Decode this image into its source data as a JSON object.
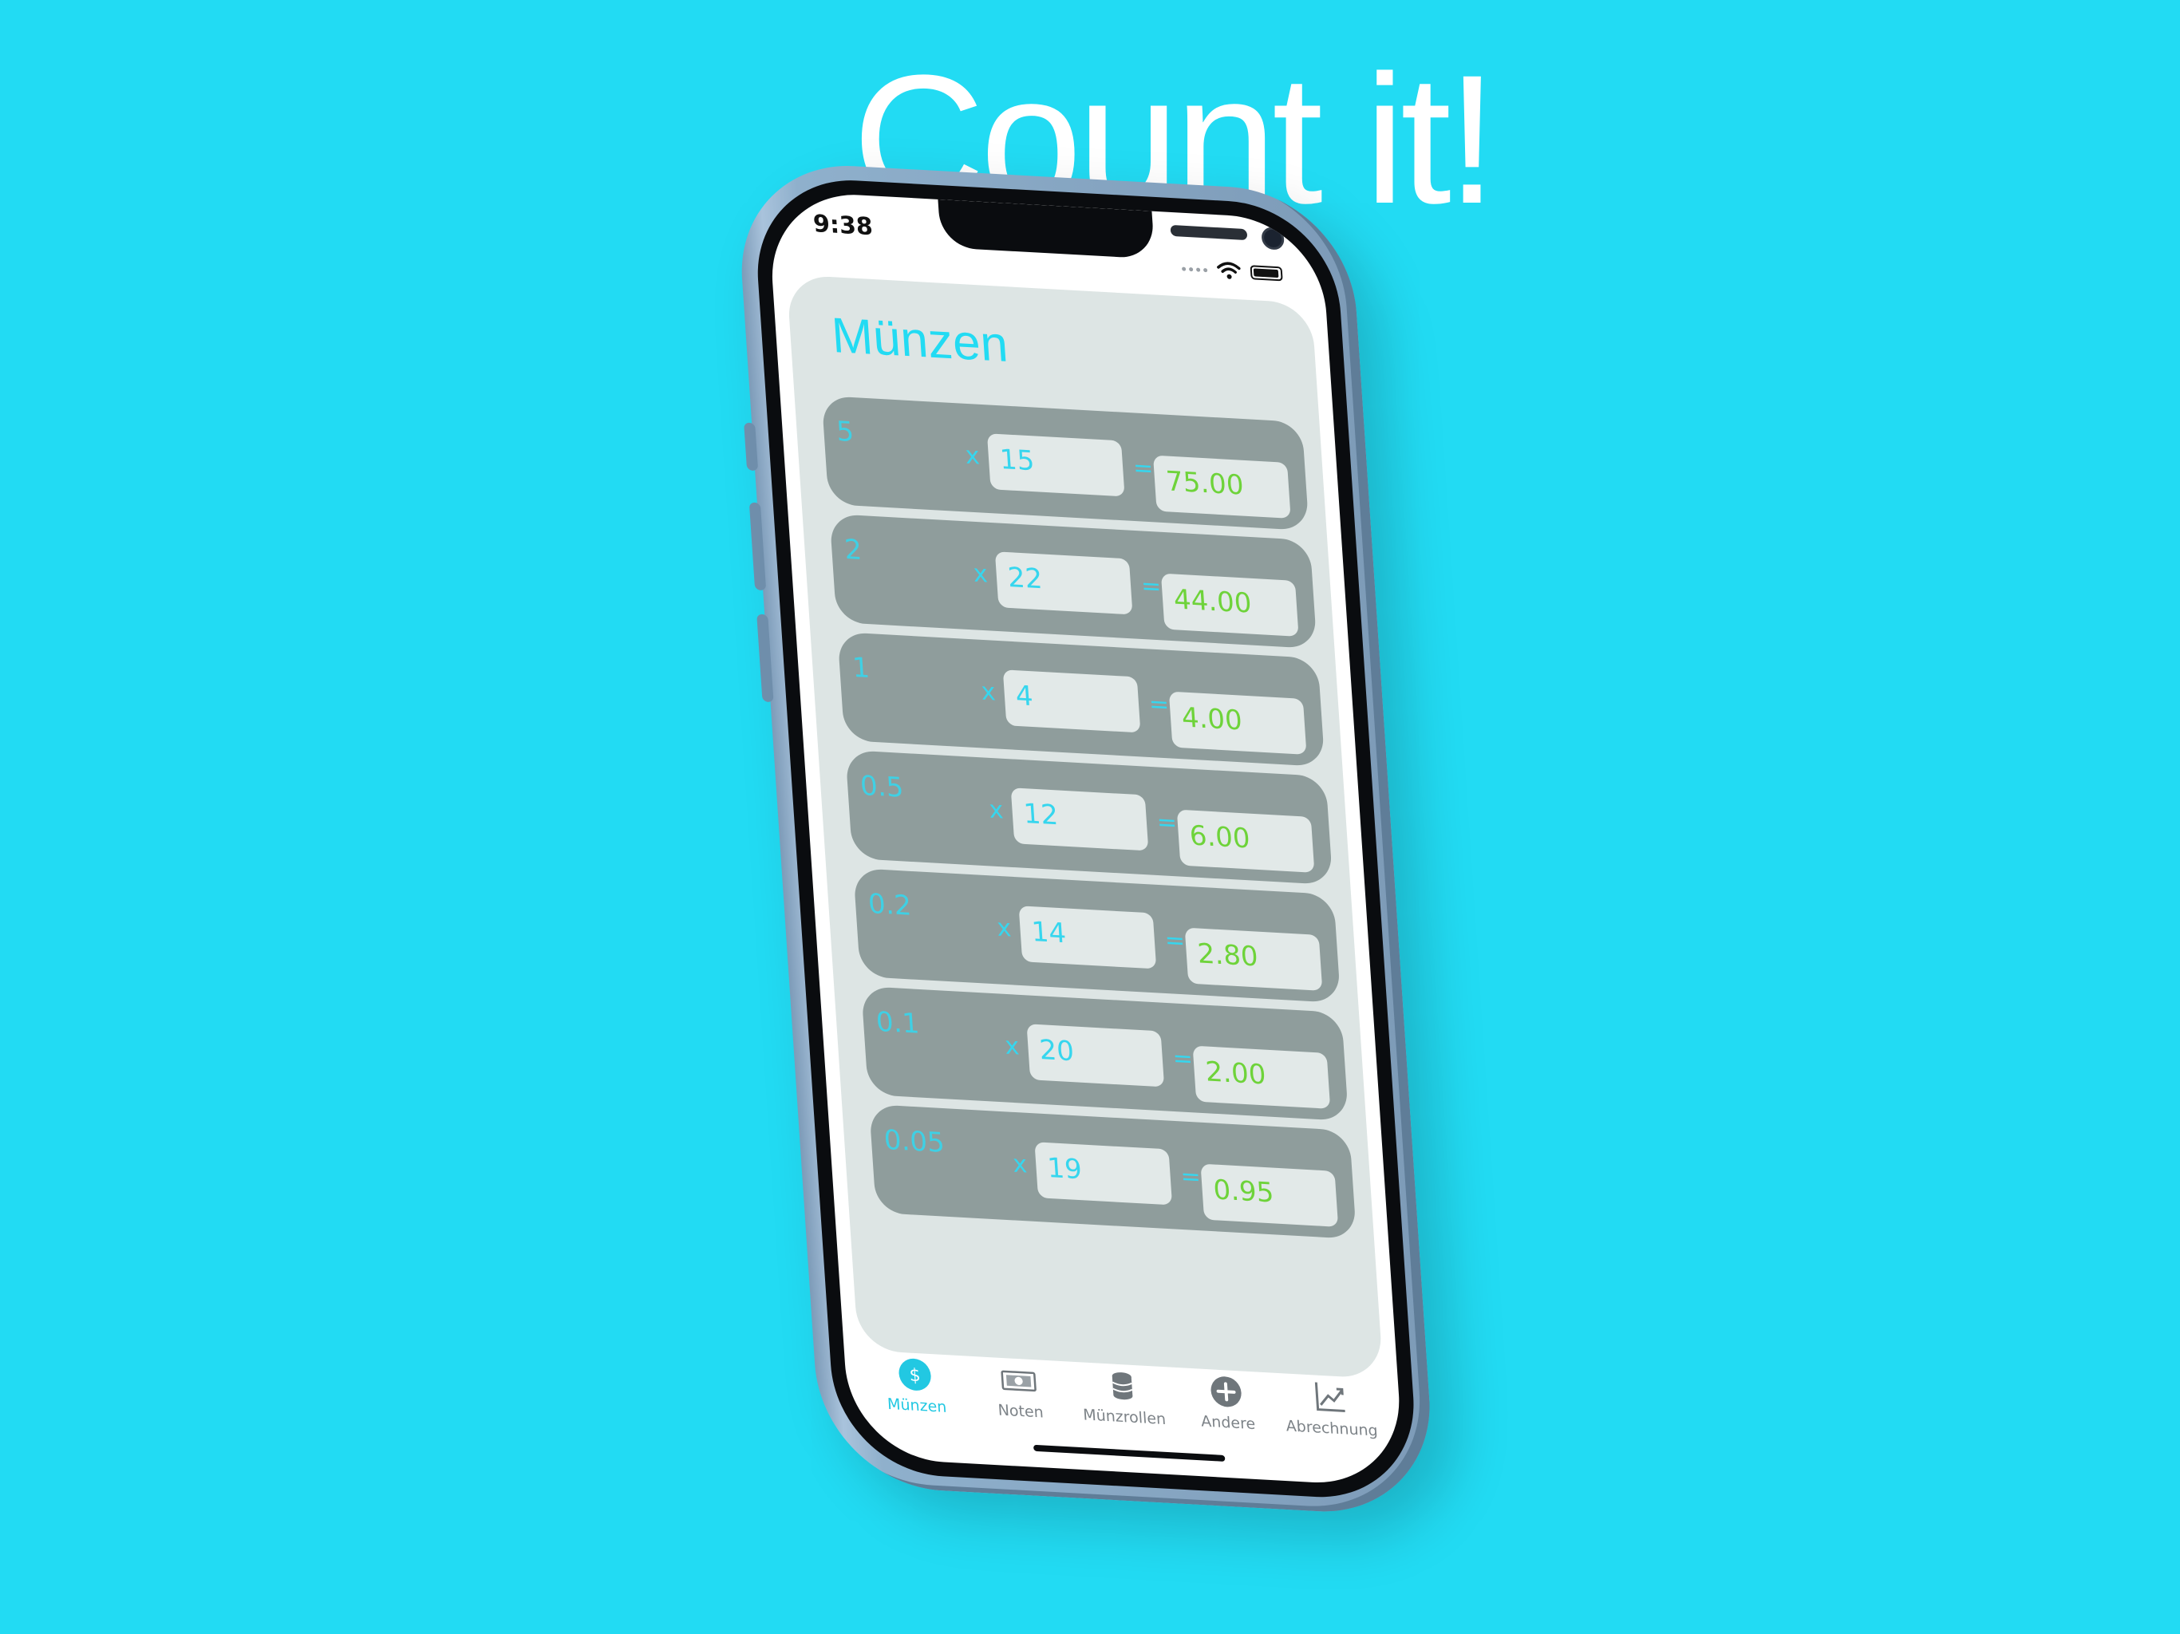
{
  "headline": "Count it!",
  "status_bar": {
    "time": "9:38",
    "icons": [
      "cellular-signal",
      "wifi",
      "battery-full"
    ]
  },
  "page": {
    "title": "Münzen"
  },
  "symbols": {
    "multiply": "x",
    "equals": "="
  },
  "rows": [
    {
      "denomination": "5",
      "quantity": "15",
      "total": "75.00"
    },
    {
      "denomination": "2",
      "quantity": "22",
      "total": "44.00"
    },
    {
      "denomination": "1",
      "quantity": "4",
      "total": "4.00"
    },
    {
      "denomination": "0.5",
      "quantity": "12",
      "total": "6.00"
    },
    {
      "denomination": "0.2",
      "quantity": "14",
      "total": "2.80"
    },
    {
      "denomination": "0.1",
      "quantity": "20",
      "total": "2.00"
    },
    {
      "denomination": "0.05",
      "quantity": "19",
      "total": "0.95"
    }
  ],
  "tabbar": {
    "tabs": [
      {
        "label": "Münzen",
        "icon": "dollar-circle-icon",
        "active": true
      },
      {
        "label": "Noten",
        "icon": "banknote-icon",
        "active": false
      },
      {
        "label": "Münzrollen",
        "icon": "coin-stack-icon",
        "active": false
      },
      {
        "label": "Andere",
        "icon": "plus-circle-icon",
        "active": false
      },
      {
        "label": "Abrechnung",
        "icon": "chart-line-icon",
        "active": false
      }
    ]
  },
  "colors": {
    "background": "#22dbf3",
    "accent": "#22dbf3",
    "total_text": "#6ed33a",
    "row_background": "#8f9d9c",
    "card_background": "#dde5e4"
  }
}
